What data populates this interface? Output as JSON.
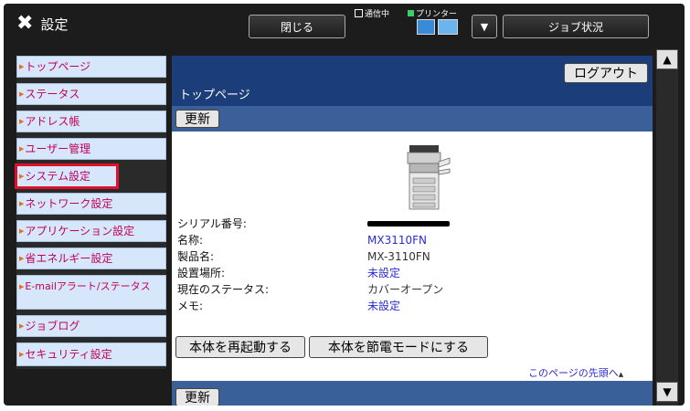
{
  "header": {
    "app_title": "設定",
    "wrench_icon": "wrench-screwdriver-icon",
    "close_label": "閉じる",
    "comm_label": "通信中",
    "printer_label": "プリンター",
    "job_status_label": "ジョブ状況",
    "dropdown_icon": "triangle-down-icon"
  },
  "sidebar": {
    "items": [
      {
        "label": "トップページ"
      },
      {
        "label": "ステータス"
      },
      {
        "label": "アドレス帳"
      },
      {
        "label": "ユーザー管理"
      },
      {
        "label": "システム設定"
      },
      {
        "label": "ネットワーク設定"
      },
      {
        "label": "アプリケーション設定"
      },
      {
        "label": "省エネルギー設定"
      },
      {
        "label": "E-mailアラート/ステータス"
      },
      {
        "label": "ジョブログ"
      },
      {
        "label": "セキュリティ設定"
      }
    ],
    "highlighted": "システム設定"
  },
  "main": {
    "logout_label": "ログアウト",
    "page_title": "トップページ",
    "update_label": "更新",
    "info": [
      {
        "label": "シリアル番号:",
        "value": ""
      },
      {
        "label": "名称:",
        "value": "MX3110FN"
      },
      {
        "label": "製品名:",
        "value": "MX-3110FN"
      },
      {
        "label": "設置場所:",
        "value": "未設定"
      },
      {
        "label": "現在のステータス:",
        "value": "カバーオープン"
      },
      {
        "label": "メモ:",
        "value": "未設定"
      }
    ],
    "reboot_label": "本体を再起動する",
    "power_save_label": "本体を節電モードにする",
    "page_top_label": "このページの先頭へ"
  },
  "colors": {
    "title_bar": "#1b3d79",
    "update_bar": "#3b5f98",
    "nav_bg": "#d7e7fb",
    "nav_text": "#c0005a",
    "link": "#2b2bd6",
    "highlight": "#e0102c"
  }
}
